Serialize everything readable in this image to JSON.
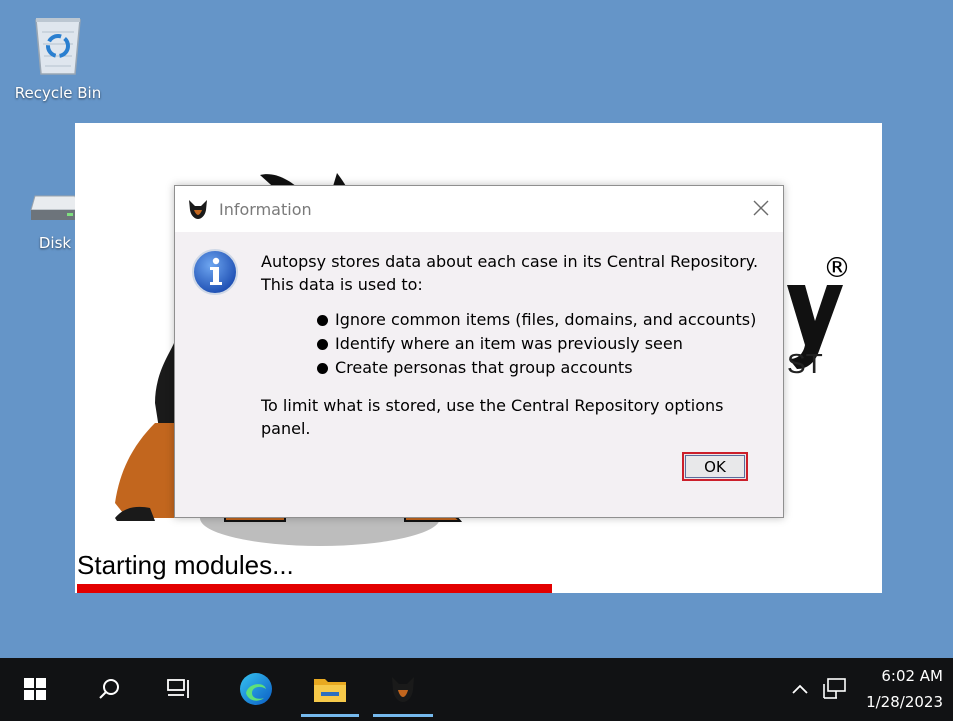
{
  "desktop": {
    "recycle_bin_label": "Recycle Bin",
    "disk_label": "Disk",
    "background_color": "#6595c8"
  },
  "splash": {
    "status_text": "Starting modules...",
    "progress_fraction": 0.59,
    "progress_color": "#e30000",
    "brand_registered_mark": "®",
    "brand_tail": "ST"
  },
  "dialog": {
    "title": "Information",
    "close_icon": "close-icon",
    "message_line1": "Autopsy stores data about each case in its Central Repository.",
    "message_line2": "This data is used to:",
    "bullets": [
      "Ignore common items (files, domains, and accounts)",
      "Identify where an item was previously seen",
      "Create personas that group accounts"
    ],
    "footer_text": "To limit what is stored, use the Central Repository options panel.",
    "ok_label": "OK"
  },
  "taskbar": {
    "items": [
      "start-icon",
      "search-icon",
      "task-view-icon",
      "edge-icon",
      "file-explorer-icon",
      "autopsy-icon"
    ],
    "tray_icons": [
      "chevron-up-icon",
      "network-icon"
    ],
    "time": "6:02 AM",
    "date": "1/28/2023"
  }
}
